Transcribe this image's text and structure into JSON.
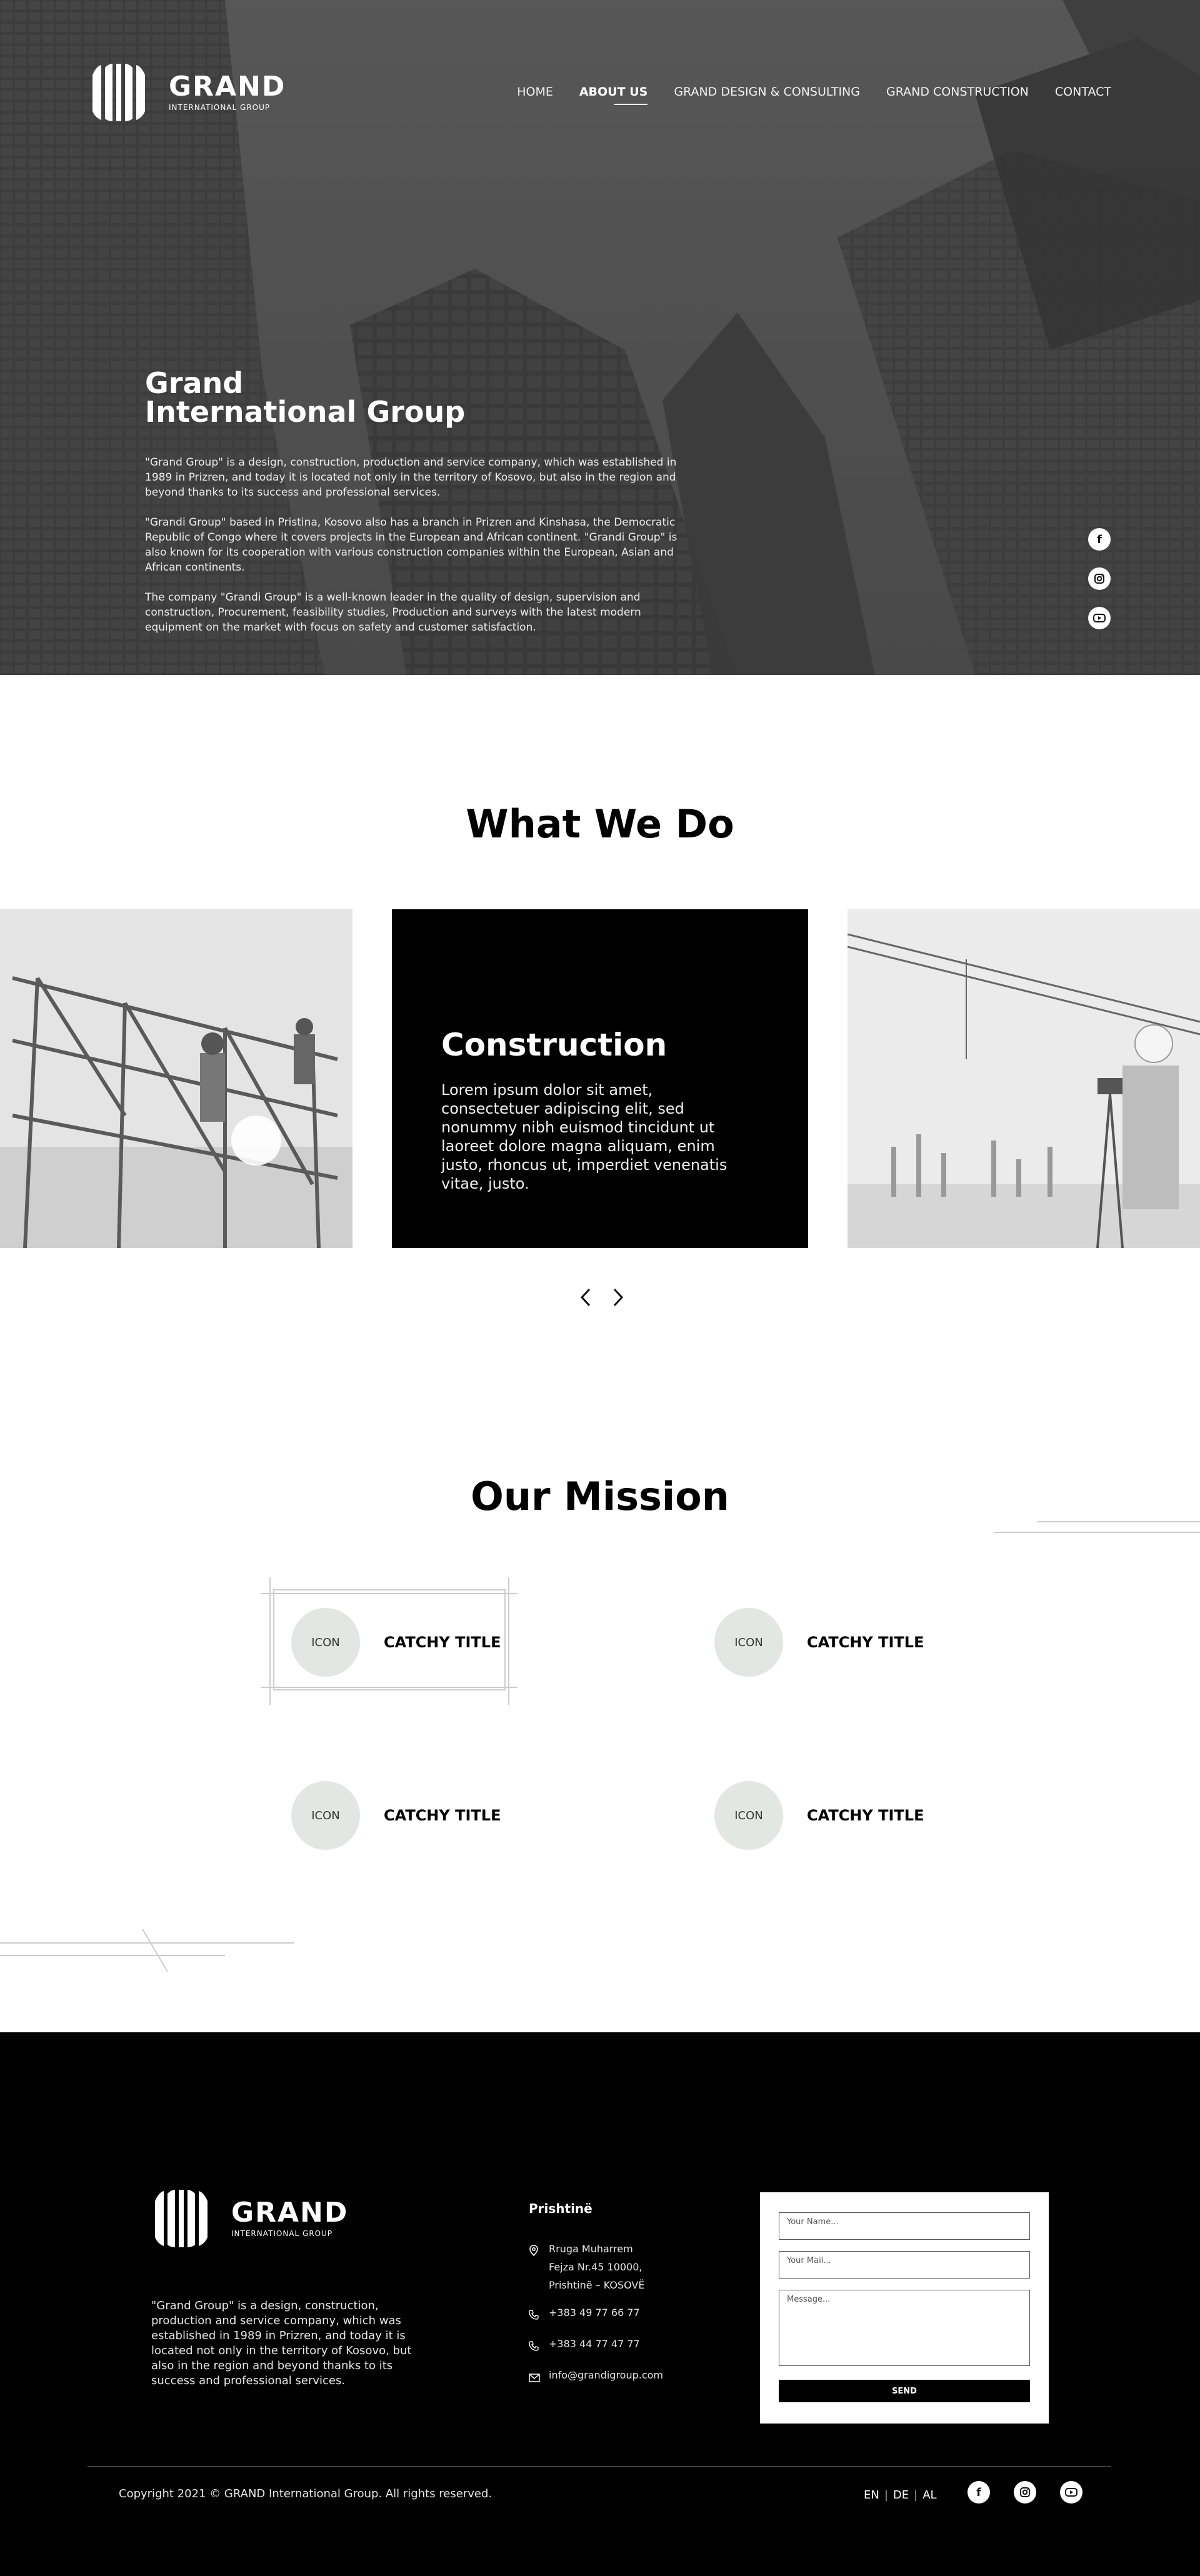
{
  "brand": {
    "name": "GRAND",
    "tagline": "INTERNATIONAL GROUP"
  },
  "nav": {
    "items": [
      {
        "label": "HOME"
      },
      {
        "label": "ABOUT US",
        "active": true
      },
      {
        "label": "GRAND DESIGN & CONSULTING"
      },
      {
        "label": "GRAND CONSTRUCTION"
      },
      {
        "label": "CONTACT"
      }
    ]
  },
  "hero": {
    "title_line1": "Grand",
    "title_line2": "International Group",
    "paragraph1": "\"Grand Group\" is a design, construction, production and service company, which was established in 1989 in Prizren, and today it is located not only in the territory of Kosovo, but also in the region and beyond thanks to its success and professional services.",
    "paragraph2": "\"Grandi Group\" based in Pristina, Kosovo also has a branch in Prizren and Kinshasa, the Democratic Republic of Congo where it covers projects in the European and African continent. \"Grandi Group\" is also known for its cooperation with various construction companies within the European, Asian and African continents.",
    "paragraph3": "The company \"Grandi Group\" is a well-known leader in the quality of design, supervision and construction, Procurement, feasibility studies, Production and surveys with the latest modern equipment on the market with focus on safety and customer satisfaction."
  },
  "social": {
    "facebook_glyph": "f",
    "icons": [
      "facebook-icon",
      "instagram-icon",
      "youtube-icon"
    ]
  },
  "what_we_do": {
    "title": "What We Do",
    "card_title": "Construction",
    "card_text": "Lorem ipsum dolor sit amet, consectetuer adipiscing elit, sed nonummy nibh euismod tincidunt ut laoreet dolore magna aliquam, enim justo, rhoncus ut, imperdiet venenatis vitae, justo."
  },
  "mission": {
    "title": "Our Mission",
    "items": [
      {
        "icon_label": "ICON",
        "title": "CATCHY TITLE"
      },
      {
        "icon_label": "ICON",
        "title": "CATCHY TITLE"
      },
      {
        "icon_label": "ICON",
        "title": "CATCHY TITLE"
      },
      {
        "icon_label": "ICON",
        "title": "CATCHY TITLE"
      }
    ]
  },
  "footer": {
    "about": "\"Grand Group\" is a design, construction, production and service company, which was established in 1989 in Prizren, and today it is located not only in the territory of Kosovo, but also in the region and beyond thanks to its success and professional services.",
    "city": "Prishtinë",
    "address_line1": "Rruga Muharrem",
    "address_line2": "Fejza Nr.45 10000,",
    "address_line3": "Prishtinë – KOSOVË",
    "phone1": "+383 49 77 66 77",
    "phone2": "+383 44 77 47 77",
    "email": "info@grandigroup.com",
    "form": {
      "name_placeholder": "Your Name...",
      "mail_placeholder": "Your Mail...",
      "message_placeholder": "Message...",
      "send_label": "SEND"
    },
    "copyright": "Copyright 2021 © GRAND International Group. All rights reserved.",
    "languages": [
      "EN",
      "DE",
      "AL"
    ]
  },
  "colors": {
    "footer_bg": "#000000",
    "icon_circle": "#e2e7e4",
    "card_bg": "#000000"
  }
}
